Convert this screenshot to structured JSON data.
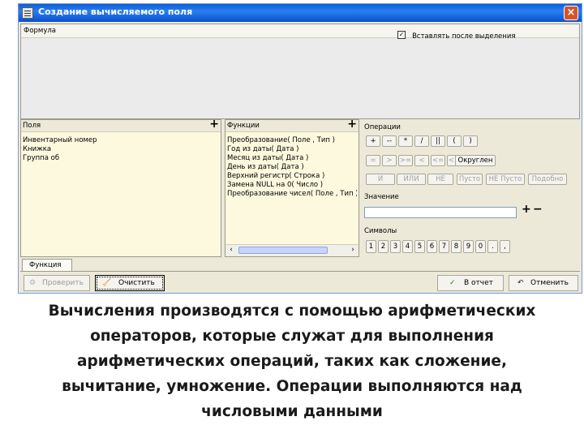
{
  "window": {
    "title": "Создание вычисляемого поля",
    "close_label": "×"
  },
  "formula": {
    "label": "Формула",
    "insert_checkbox_label": "Вставлять после выделения",
    "insert_checked": true,
    "check_mark": "✓"
  },
  "fields_panel": {
    "label": "Поля",
    "add_label": "+",
    "items": [
      "Инвентарный номер",
      "Книжка",
      "Группа об"
    ]
  },
  "functions_panel": {
    "label": "Функции",
    "add_label": "+",
    "items": [
      "Преобразование( Поле , Тип )",
      "Год из даты( Дата )",
      "Месяц из даты( Дата )",
      "День из даты( Дата )",
      "Верхний регистр( Строка )",
      "Замена NULL на 0( Число )",
      "Преобразование чисел( Поле , Тип )"
    ],
    "scroll_left": "‹",
    "scroll_right": "›"
  },
  "operations": {
    "label": "Операции",
    "row1": [
      "+",
      "--",
      "*",
      "/",
      "||",
      "(",
      ")"
    ],
    "row2": [
      "=",
      ">",
      ">=",
      "<",
      "<=",
      "<>"
    ],
    "round_label": "Округлен",
    "row3": [
      "И",
      "ИЛИ",
      "НЕ",
      "Пусто",
      "НЕ Пусто",
      "Подобно"
    ]
  },
  "value": {
    "label": "Значение",
    "plus": "+",
    "minus": "−"
  },
  "symbols": {
    "label": "Символы",
    "items": [
      "1",
      "2",
      "3",
      "4",
      "5",
      "6",
      "7",
      "8",
      "9",
      "0",
      ".",
      ","
    ]
  },
  "tab": {
    "label": "Функция"
  },
  "bottom": {
    "check_label": "Проверить",
    "clear_label": "Очистить",
    "to_report_label": "В отчет",
    "cancel_label": "Отменить"
  },
  "caption": {
    "lines": [
      "Вычисления производятся  с помощью арифметических",
      "операторов, которые служат для выполнения",
      "арифметических операций, таких как сложение,",
      "вычитание, умножение. Операции выполняются над",
      "числовыми данными"
    ]
  }
}
